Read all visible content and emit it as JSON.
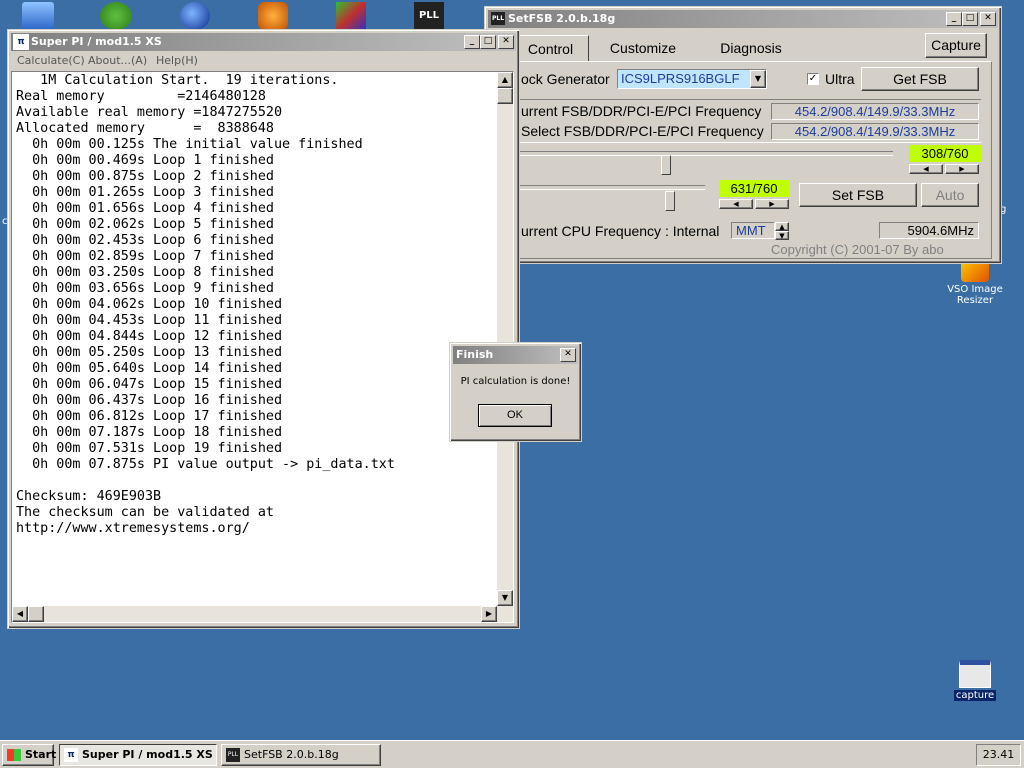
{
  "desktop": {
    "icons": [
      {
        "label": "VSO Image Resizer"
      },
      {
        "label": "capture"
      }
    ]
  },
  "superpi": {
    "title": "Super PI / mod1.5 XS",
    "menu": [
      "Calculate(C)",
      "About...(A)",
      "Help(H)"
    ],
    "output": "   1M Calculation Start.  19 iterations.\nReal memory         =2146480128\nAvailable real memory =1847275520\nAllocated memory      =  8388648\n  0h 00m 00.125s The initial value finished\n  0h 00m 00.469s Loop 1 finished\n  0h 00m 00.875s Loop 2 finished\n  0h 00m 01.265s Loop 3 finished\n  0h 00m 01.656s Loop 4 finished\n  0h 00m 02.062s Loop 5 finished\n  0h 00m 02.453s Loop 6 finished\n  0h 00m 02.859s Loop 7 finished\n  0h 00m 03.250s Loop 8 finished\n  0h 00m 03.656s Loop 9 finished\n  0h 00m 04.062s Loop 10 finished\n  0h 00m 04.453s Loop 11 finished\n  0h 00m 04.844s Loop 12 finished\n  0h 00m 05.250s Loop 13 finished\n  0h 00m 05.640s Loop 14 finished\n  0h 00m 06.047s Loop 15 finished\n  0h 00m 06.437s Loop 16 finished\n  0h 00m 06.812s Loop 17 finished\n  0h 00m 07.187s Loop 18 finished\n  0h 00m 07.531s Loop 19 finished\n  0h 00m 07.875s PI value output -> pi_data.txt\n\nChecksum: 469E903B\nThe checksum can be validated at\nhttp://www.xtremesystems.org/"
  },
  "setfsb": {
    "title": "SetFSB 2.0.b.18g",
    "tabs": {
      "control": "Control",
      "customize": "Customize",
      "diagnosis": "Diagnosis"
    },
    "capture_label": "Capture",
    "clock_generator_label": "ock Generator",
    "clock_generator_value": "ICS9LPRS916BGLF",
    "ultra_label": "Ultra",
    "ultra_checked": true,
    "get_fsb_label": "Get FSB",
    "current_freq_label": "urrent FSB/DDR/PCI-E/PCI Frequency",
    "current_freq_value": "454.2/908.4/149.9/33.3MHz",
    "select_freq_label": "Select FSB/DDR/PCI-E/PCI Frequency",
    "select_freq_value": "454.2/908.4/149.9/33.3MHz",
    "slider1_value": "308/760",
    "slider2_value": "631/760",
    "set_fsb_label": "Set FSB",
    "auto_label": "Auto",
    "cpu_freq_label": "urrent CPU Frequency : Internal",
    "cpu_source": "MMT",
    "cpu_freq_value": "5904.6MHz",
    "copyright": "Copyright (C) 2001-07 By abo"
  },
  "dialog": {
    "title": "Finish",
    "message": "PI calculation is done!",
    "ok_label": "OK"
  },
  "taskbar": {
    "start_label": "Start",
    "tasks": [
      "Super PI / mod1.5 XS",
      "SetFSB 2.0.b.18g"
    ],
    "clock": "23.41"
  }
}
